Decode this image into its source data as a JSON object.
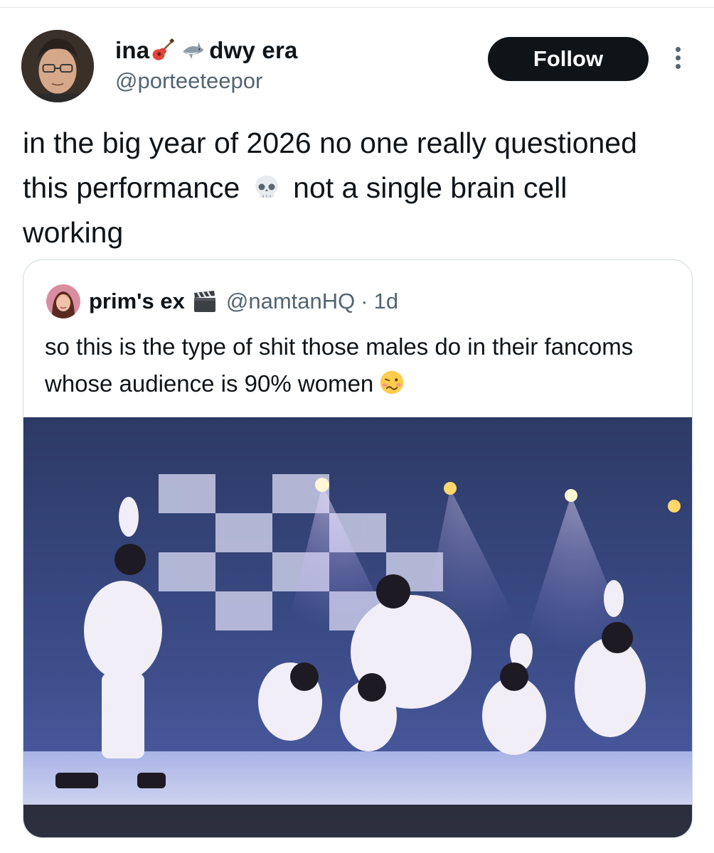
{
  "tweet": {
    "display_name_left": "ina",
    "display_name_right": "dwy era",
    "name_icons": [
      "guitar-icon",
      "shark-icon"
    ],
    "handle": "@porteeteepor",
    "follow_label": "Follow",
    "text_part1": "in the big year of 2026 no one really questioned this performance",
    "text_emoji": "skull-icon",
    "text_part2": "not a single brain cell working"
  },
  "quote": {
    "display_name": "prim's ex",
    "name_icon": "clapperboard-icon",
    "handle": "@namtanHQ",
    "separator": "·",
    "time": "1d",
    "text": "so this is the type of shit those males do in their fancoms whose audience is 90% women",
    "text_emoji": "woozy-face-icon"
  },
  "colors": {
    "text_primary": "#0f1419",
    "text_secondary": "#536471",
    "follow_bg": "#0f1419",
    "border": "#cfd9de"
  }
}
